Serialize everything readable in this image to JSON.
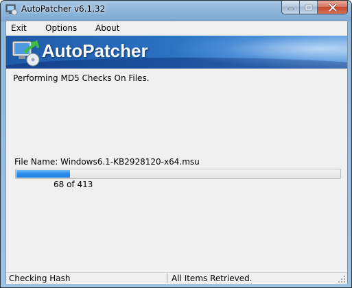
{
  "window": {
    "title": "AutoPatcher v6.1.32"
  },
  "menu": {
    "items": [
      {
        "label": "Exit"
      },
      {
        "label": "Options"
      },
      {
        "label": "About"
      }
    ]
  },
  "banner": {
    "brand": "AutoPatcher"
  },
  "main": {
    "status_message": "Performing MD5 Checks On Files.",
    "file_name": "File Name: Windows6.1-KB2928120-x64.msu",
    "progress": {
      "current": 68,
      "total": 413,
      "fraction": 0.165,
      "label": "68 of 413"
    }
  },
  "statusbar": {
    "left": "Checking Hash",
    "right": "All Items Retrieved."
  },
  "colors": {
    "banner": "#2a70c0",
    "progress": "#2a8ceb"
  }
}
